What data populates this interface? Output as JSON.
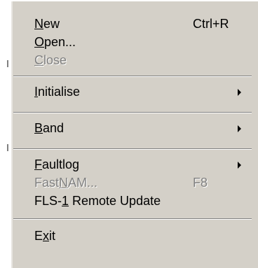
{
  "menu": {
    "items": [
      {
        "pre": "",
        "ul": "N",
        "post": "ew",
        "shortcut": "Ctrl+R"
      },
      {
        "pre": "",
        "ul": "O",
        "post": "pen...",
        "shortcut": ""
      },
      {
        "pre": "",
        "ul": "C",
        "post": "lose",
        "shortcut": ""
      },
      {
        "pre": "",
        "ul": "I",
        "post": "nitialise",
        "shortcut": ""
      },
      {
        "pre": "",
        "ul": "B",
        "post": "and",
        "shortcut": ""
      },
      {
        "pre": "",
        "ul": "F",
        "post": "aultlog",
        "shortcut": ""
      },
      {
        "pre": "Fast",
        "ul": "N",
        "post": "AM...",
        "shortcut": "F8"
      },
      {
        "pre": "FLS-",
        "ul": "1",
        "post": " Remote Update",
        "shortcut": ""
      },
      {
        "pre": "E",
        "ul": "x",
        "post": "it",
        "shortcut": ""
      }
    ]
  }
}
